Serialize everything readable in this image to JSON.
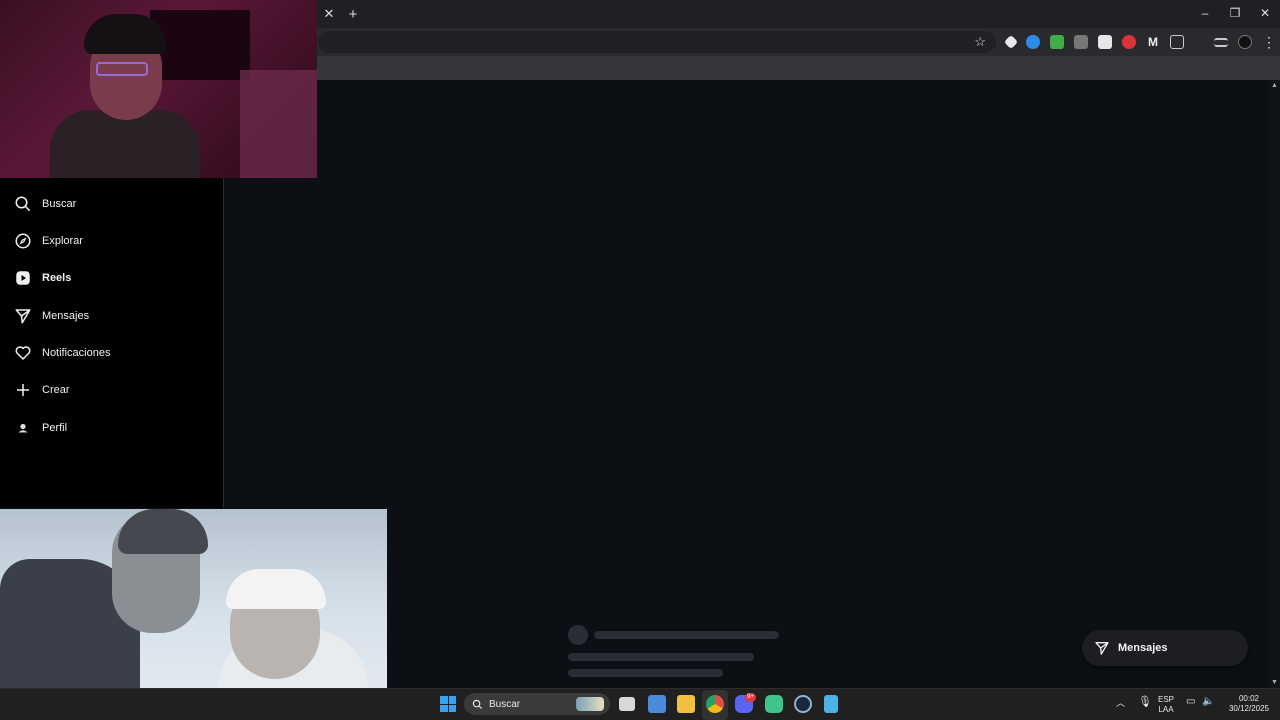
{
  "browser": {
    "tab_close": "✕",
    "new_tab": "+",
    "window_controls": {
      "minimize": "–",
      "restore": "❐",
      "close": "✕"
    },
    "menu": "⋮"
  },
  "sidebar": {
    "items": [
      {
        "label": "Buscar",
        "icon": "search-icon"
      },
      {
        "label": "Explorar",
        "icon": "compass-icon"
      },
      {
        "label": "Reels",
        "icon": "reels-icon"
      },
      {
        "label": "Mensajes",
        "icon": "send-icon"
      },
      {
        "label": "Notificaciones",
        "icon": "heart-icon"
      },
      {
        "label": "Crear",
        "icon": "plus-icon"
      },
      {
        "label": "Perfil",
        "icon": "avatar-icon"
      }
    ]
  },
  "messages_button": {
    "label": "Mensajes"
  },
  "taskbar": {
    "search_label": "Buscar",
    "lang_top": "ESP",
    "lang_bottom": "LAA",
    "time": "00:02",
    "date": "30/12/2025",
    "discord_badge": "9+"
  },
  "colors": {
    "accent_reels": "#ffffff",
    "page_bg": "#0c0f14"
  }
}
